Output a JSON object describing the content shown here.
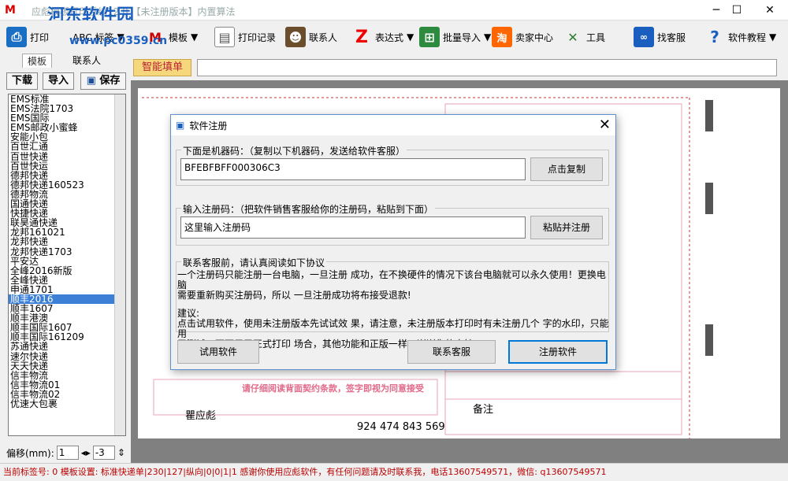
{
  "window": {
    "title": "应彪模板打印系统12.8 【未注册版本】内置算法",
    "watermark": "河东软件园",
    "watermark_url": "www.pc0359.cn",
    "minimize": "─",
    "maximize": "☐",
    "close": "✕"
  },
  "toolbar": {
    "items": [
      {
        "label": "打印",
        "icon": "print-icon"
      },
      {
        "label": "ABC 标签",
        "icon": "abc-icon"
      },
      {
        "label": "模板",
        "icon": "template-icon"
      },
      {
        "label": "打印记录",
        "icon": "print-record-icon"
      },
      {
        "label": "联系人",
        "icon": "contact-icon"
      },
      {
        "label": "表达式",
        "icon": "expression-icon"
      },
      {
        "label": "批量导入",
        "icon": "batch-import-icon"
      },
      {
        "label": "卖家中心",
        "icon": "seller-center-icon"
      },
      {
        "label": "工具",
        "icon": "tools-icon"
      },
      {
        "label": "找客服",
        "icon": "customer-service-icon"
      },
      {
        "label": "软件教程",
        "icon": "help-icon"
      }
    ]
  },
  "left_panel": {
    "tabs": [
      "模板",
      "联系人"
    ],
    "download": "下载",
    "import": "导入",
    "save": "保存",
    "templates": [
      "EMS标准",
      "EMS法院1703",
      "EMS国际",
      "EMS邮政小蜜蜂",
      "安能小包",
      "百世汇通",
      "百世快递",
      "百世快运",
      "德邦快递",
      "德邦快递160523",
      "德邦物流",
      "国通快递",
      "快捷快递",
      "联昊通快递",
      "龙邦161021",
      "龙邦快递",
      "龙邦快递1703",
      "平安达",
      "全峰2016新版",
      "全峰快递",
      "申通1701",
      "顺丰2016",
      "顺丰1607",
      "顺丰港澳",
      "顺丰国际1607",
      "顺丰国际161209",
      "苏通快递",
      "速尔快递",
      "天天快递",
      "信丰物流",
      "信丰物流01",
      "信丰物流02",
      "优速大包裹"
    ],
    "selected": "顺丰2016",
    "offset_label": "偏移(mm):",
    "offset_x": "1",
    "offset_y": "-3"
  },
  "smart_fill": {
    "label": "智能填单",
    "value": ""
  },
  "waybill": {
    "sender_name": "瞿应彪",
    "remark": "备注",
    "tracking": "924 474 843 569",
    "notice": "请仔细阅读背面契约条款，签字即视为同意接受"
  },
  "dialog": {
    "title": "软件注册",
    "machine_group": "下面是机器码：（复制以下机器码，发送给软件客服）",
    "machine_code": "BFEBFBFF000306C3",
    "copy_button": "点击复制",
    "reg_group": "输入注册码：（把软件销售客服给你的注册码，粘贴到下面）",
    "reg_placeholder": "这里输入注册码",
    "paste_button": "粘贴并注册",
    "agreement_title": "联系客服前，请认真阅读如下协议",
    "agreement_line1": "    一个注册码只能注册一台电脑，一旦注册 成功，在不换硬件的情况下该台电脑就可以永久使用！更换电脑",
    "agreement_line2": "需要重新购买注册码，所以 一旦注册成功将布接受退款!",
    "suggest_title": "建议:",
    "suggest_line1": "点击试用软件，使用未注册版本先试试效 果，请注意，未注册版本打印时有未注册几个 字的水印，只能用",
    "suggest_line2": "于测试，不可用于正式打印 场合，其他功能和正版一样，谢谢你的支持!",
    "trial_button": "试用软件",
    "contact_button": "联系客服",
    "register_button": "注册软件"
  },
  "status": {
    "text": "当前标签号: 0   模板设置: 标准快递单|230|127|纵向|0|0|1|1   感谢你使用应彪软件，有任何问题请及时联系我，电话13607549571，微信: q13607549571"
  }
}
